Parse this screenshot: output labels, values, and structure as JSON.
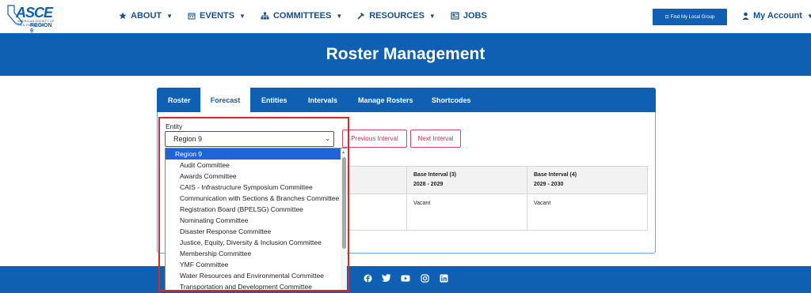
{
  "header": {
    "logo": {
      "brand": "ASCE",
      "subtitle": "AMERICAN SOCIETY OF CIVIL ENGINEERS",
      "region": "REGION 9"
    },
    "nav": [
      {
        "label": "ABOUT",
        "icon": "star-icon"
      },
      {
        "label": "EVENTS",
        "icon": "calendar-icon"
      },
      {
        "label": "COMMITTEES",
        "icon": "sitemap-icon"
      },
      {
        "label": "RESOURCES",
        "icon": "hammer-icon"
      },
      {
        "label": "JOBS",
        "icon": "newspaper-icon"
      }
    ],
    "find_group_label": "Find My Local Group",
    "account_label": "My Account"
  },
  "page": {
    "title": "Roster Management"
  },
  "tabs": [
    "Roster",
    "Forecast",
    "Entities",
    "Intervals",
    "Manage Rosters",
    "Shortcodes"
  ],
  "active_tab": "Forecast",
  "form": {
    "entity_label": "Entity",
    "entity_value": "Region 9",
    "prev_button": "Previous Interval",
    "next_button": "Next Interval"
  },
  "table": {
    "columns": [
      {
        "title": "Base Interval (3)",
        "years": "2028 - 2029"
      },
      {
        "title": "Base Interval (4)",
        "years": "2029 - 2030"
      }
    ],
    "rows": [
      [
        "Vacant",
        "Vacant"
      ]
    ]
  },
  "dropdown": {
    "options": [
      "Region 9",
      "Audit Committee",
      "Awards Committee",
      "CAIS - Infrastructure Symposium Committee",
      "Communication with Sections & Branches Committee",
      "Registration Board (BPELSG) Committee",
      "Nominating Committee",
      "Disaster Response Committee",
      "Justice, Equity, Diversity & Inclusion Committee",
      "Membership Committee",
      "YMF Committee",
      "Water Resources and Environmental Committee",
      "Transportation and Development Committee"
    ],
    "selected_index": 0
  },
  "footer": {
    "social": [
      "facebook-icon",
      "twitter-icon",
      "youtube-icon",
      "instagram-icon",
      "linkedin-icon"
    ]
  },
  "colors": {
    "brand_blue": "#0f5fb3",
    "highlight_red": "#d22b2b",
    "button_pink": "#c9365a"
  }
}
